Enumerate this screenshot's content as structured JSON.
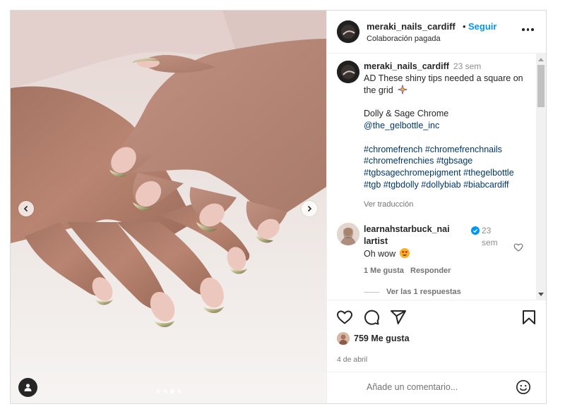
{
  "post": {
    "author": "meraki_nails_cardiff",
    "separator": "•",
    "follow_label": "Seguir",
    "paid_label": "Colaboración pagada",
    "more_icon": "more-horizontal-icon"
  },
  "caption": {
    "username": "meraki_nails_cardiff",
    "time": "23 sem",
    "line1": "AD These shiny tips needed a square on the grid",
    "emoji": "sparkles-emoji",
    "line2": "Dolly & Sage Chrome",
    "mention": "@the_gelbottle_inc",
    "hashtags": "#chromefrench #chromefrenchnails #chromefrenchies #tgbsage #tgbsagechromepigment #thegelbottle #tgb #tgbdolly #dollybiab #biabcardiff",
    "translate_label": "Ver traducción"
  },
  "comment": {
    "username": "learnahstarbuck_nailartist",
    "verified_icon": "verified-badge-icon",
    "time": "23 sem",
    "text": "Oh wow",
    "emoji": "heart-eyes-emoji",
    "likes": "1 Me gusta",
    "reply_label": "Responder",
    "view_replies": "Ver las 1 respuestas"
  },
  "actions": {
    "like_icon": "heart-icon",
    "comment_icon": "comment-icon",
    "share_icon": "send-icon",
    "save_icon": "bookmark-icon"
  },
  "likes": {
    "count": "759",
    "label": "Me gusta"
  },
  "date": "4 de abril",
  "add_comment": {
    "placeholder": "Añade un comentario...",
    "emoji_icon": "smiley-icon"
  },
  "carousel": {
    "total": 4,
    "active": 3
  },
  "colors": {
    "accent": "#0095f6",
    "text": "#262626",
    "muted": "#737373",
    "link": "#00376b"
  }
}
